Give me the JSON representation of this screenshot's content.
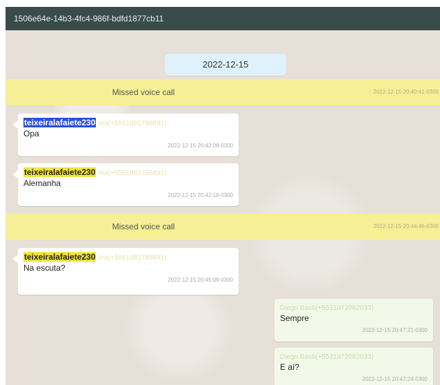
{
  "window": {
    "title": "1506e64e-14b3-4fc4-986f-bdfd1877cb11"
  },
  "date_separator": "2022-12-15",
  "missed_calls": [
    {
      "label": "Missed voice call",
      "timestamp": "2022-12-15 20:40:41-0300"
    },
    {
      "label": "Missed voice call",
      "timestamp": "2022-12-15 20:44:46-0300"
    }
  ],
  "messages": [
    {
      "direction": "in",
      "sender": "teixeiralafaiete230",
      "phone": "tea(+5561981788891)",
      "text": "Opa",
      "timestamp": "2022-12-15 20:42:08-0300"
    },
    {
      "direction": "in",
      "sender": "teixeiralafaiete230",
      "phone": "tea(+5561981788891)",
      "text": "Alemanha",
      "timestamp": "2022-12-15 20:42:16-0300"
    },
    {
      "direction": "in",
      "sender": "teixeiralafaiete230",
      "phone": "tea(+5561981788891)",
      "text": "Na escuta?",
      "timestamp": "2022-12-15 20:45:09-0300"
    },
    {
      "direction": "out",
      "sender": "Diego Basti(+5531972082033)",
      "text": "Sempre",
      "timestamp": "2022-12-15 20:47:21-0300"
    },
    {
      "direction": "out",
      "sender": "Diego Basti(+5531972082033)",
      "text": "E aí?",
      "timestamp": "2022-12-15 20:47:24-0300"
    }
  ],
  "colors": {
    "titlebar": "#3a4b4c",
    "call_bar": "#f6ef95",
    "date_chip": "#dff1fb",
    "name_highlight": "#f0e43c",
    "selection": "#2b4fd8"
  }
}
